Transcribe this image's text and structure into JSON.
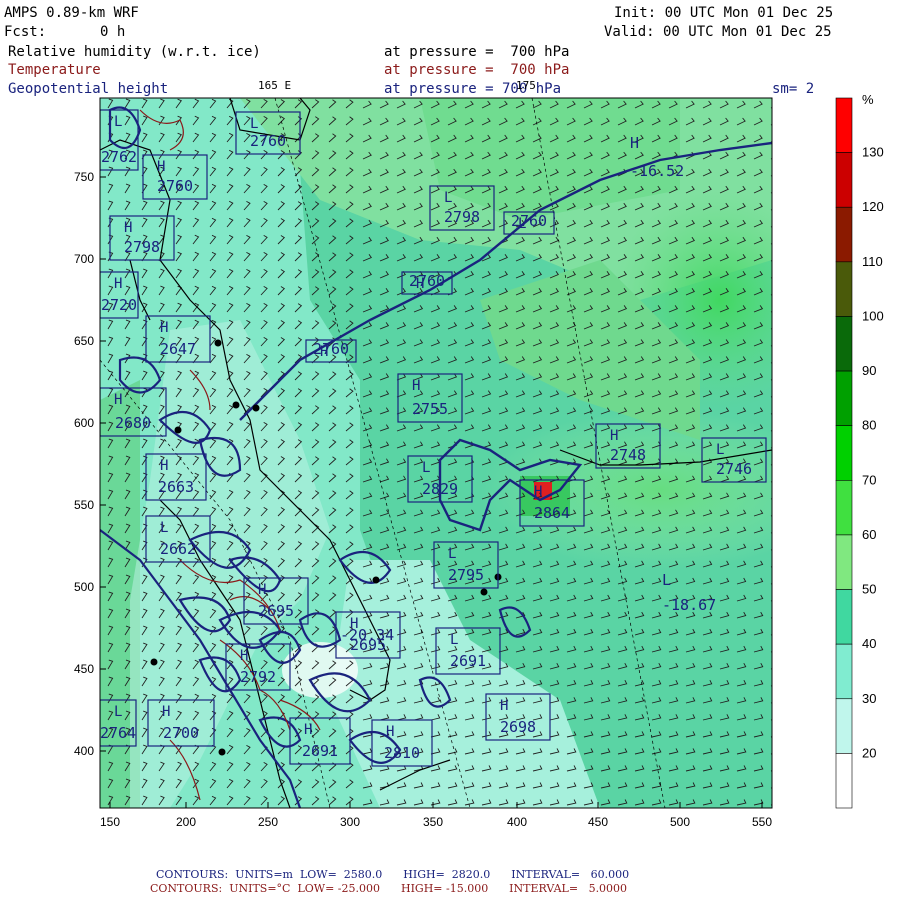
{
  "header": {
    "model": "AMPS 0.89-km WRF",
    "init": "Init: 00 UTC Mon 01 Dec 25",
    "forecast_label": "Fcst:",
    "forecast_value": "0 h",
    "valid": "Valid: 00 UTC Mon 01 Dec 25",
    "field1": "Relative humidity (w.r.t. ice)",
    "field1_level": "at pressure =  700 hPa",
    "field2": "Temperature",
    "field2_level": "at pressure =  700 hPa",
    "field3": "Geopotential height",
    "field3_level": "at pressure = 700 hPa",
    "smoothing": "sm= 2"
  },
  "map_labels": {
    "lon_165e": "165 E",
    "lon_175": "175"
  },
  "axes": {
    "x_ticks": [
      "150",
      "200",
      "250",
      "300",
      "350",
      "400",
      "450",
      "500",
      "550"
    ],
    "y_ticks": [
      "750",
      "700",
      "650",
      "600",
      "550",
      "500",
      "450",
      "400"
    ]
  },
  "colorbar": {
    "unit": "%",
    "labels": [
      "130",
      "120",
      "110",
      "100",
      "90",
      "80",
      "70",
      "60",
      "50",
      "40",
      "30",
      "20"
    ],
    "colors": [
      "#ff0000",
      "#cc0000",
      "#8b1a00",
      "#4a5a0a",
      "#0a6a0a",
      "#00a000",
      "#00d000",
      "#40e040",
      "#80e880",
      "#40d8a0",
      "#80ecd0",
      "#c0f6ec",
      "#ffffff"
    ]
  },
  "contour_labels": [
    {
      "text": "2760",
      "kind": "box"
    },
    {
      "text": "2760",
      "kind": "box"
    },
    {
      "text": "2760",
      "kind": "box"
    },
    {
      "text": "2760",
      "kind": "box"
    },
    {
      "text": "2760",
      "kind": "box"
    },
    {
      "text": "2798",
      "kind": "box"
    },
    {
      "text": "2798",
      "kind": "box"
    },
    {
      "text": "2755",
      "kind": "box"
    },
    {
      "text": "2748",
      "kind": "box"
    },
    {
      "text": "2746",
      "kind": "box"
    },
    {
      "text": "2680",
      "kind": "box"
    },
    {
      "text": "2663",
      "kind": "box"
    },
    {
      "text": "2662",
      "kind": "box"
    },
    {
      "text": "2647",
      "kind": "box"
    },
    {
      "text": "2720",
      "kind": "box"
    },
    {
      "text": "2829",
      "kind": "box"
    },
    {
      "text": "2695",
      "kind": "box"
    },
    {
      "text": "2695",
      "kind": "box"
    },
    {
      "text": "2691",
      "kind": "box"
    },
    {
      "text": "2698",
      "kind": "box"
    },
    {
      "text": "2700",
      "kind": "box"
    },
    {
      "text": "2764",
      "kind": "box"
    },
    {
      "text": "2810",
      "kind": "box"
    },
    {
      "text": "2792",
      "kind": "box"
    },
    {
      "text": "2795",
      "kind": "box"
    },
    {
      "text": "2691",
      "kind": "box"
    },
    {
      "text": "2864",
      "kind": "box"
    },
    {
      "text": "2762",
      "kind": "box"
    }
  ],
  "extrema": [
    {
      "text": "-16.52"
    },
    {
      "text": "-18.67"
    },
    {
      "text": "-20.34"
    },
    {
      "text": "H"
    },
    {
      "text": "L"
    }
  ],
  "footer": {
    "line1": "CONTOURS:  UNITS=m  LOW=  2580.0      HIGH=  2820.0      INTERVAL=   60.000",
    "line2": "CONTOURS:  UNITS=°C  LOW= -25.000      HIGH= -15.000      INTERVAL=   5.0000"
  },
  "colors": {
    "navy": "#1a237e",
    "maroon": "#8b1a1a",
    "coast": "#000000",
    "contour": "#1a237e"
  }
}
